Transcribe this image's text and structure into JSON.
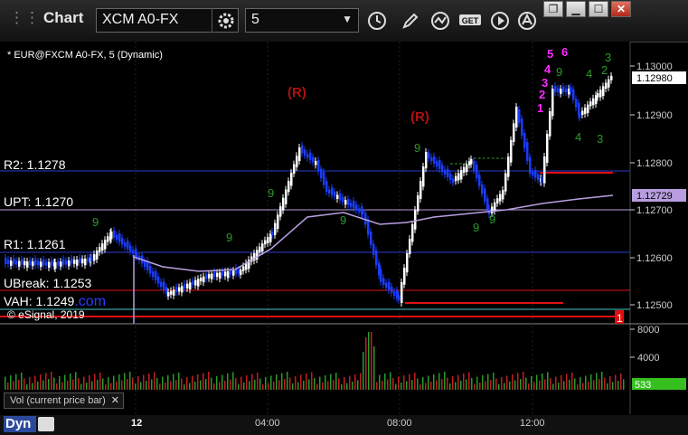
{
  "title_bar": {
    "app_title": "Chart",
    "symbol": "XCM A0-FX",
    "interval": "5",
    "window_buttons": [
      "restore",
      "minimize",
      "maximize",
      "close"
    ]
  },
  "chart": {
    "info": "* EUR@FXCM A0-FX, 5 (Dynamic)",
    "copyright": "© eSignal, 2019",
    "com_text": ".com",
    "price_labels": [
      "1.13000",
      "1.12900",
      "1.12800",
      "1.12700",
      "1.12600",
      "1.12500"
    ],
    "current_price": "1.12980",
    "ma_price": "1.12729",
    "levels": [
      {
        "label": "R2: 1.1278"
      },
      {
        "label": "UPT: 1.1270"
      },
      {
        "label": "R1: 1.1261"
      },
      {
        "label": "UBreak: 1.1253"
      },
      {
        "label": "VAH: 1.1249"
      }
    ],
    "r_markers": [
      "(R)",
      "(R)"
    ],
    "bottom_marker": "1",
    "magenta_labels": [
      "5",
      "6",
      "4",
      "3",
      "2",
      "1"
    ],
    "green_labels": [
      "3",
      "2",
      "4",
      "9",
      "4",
      "3",
      "9",
      "9",
      "9",
      "9",
      "9",
      "9",
      "9"
    ]
  },
  "volume": {
    "label": "Vol (current price bar)",
    "scale": [
      "8000",
      "4000"
    ],
    "current": "533"
  },
  "bottom": {
    "dyn": "Dyn",
    "times": [
      "12",
      "04:00",
      "08:00",
      "12:00"
    ]
  },
  "colors": {
    "up": "#ffffff",
    "down": "#1a3cff",
    "ma": "#b89ee0",
    "level_line": "#2b3bd0",
    "red_line": "#e01010",
    "green_text": "#2a9a2a",
    "magenta": "#ff2bff",
    "r_marker": "#b01010"
  },
  "icons": [
    "gear-icon",
    "clock-icon",
    "pencil-icon",
    "study-icon",
    "get-icon",
    "play-icon",
    "at-icon"
  ]
}
